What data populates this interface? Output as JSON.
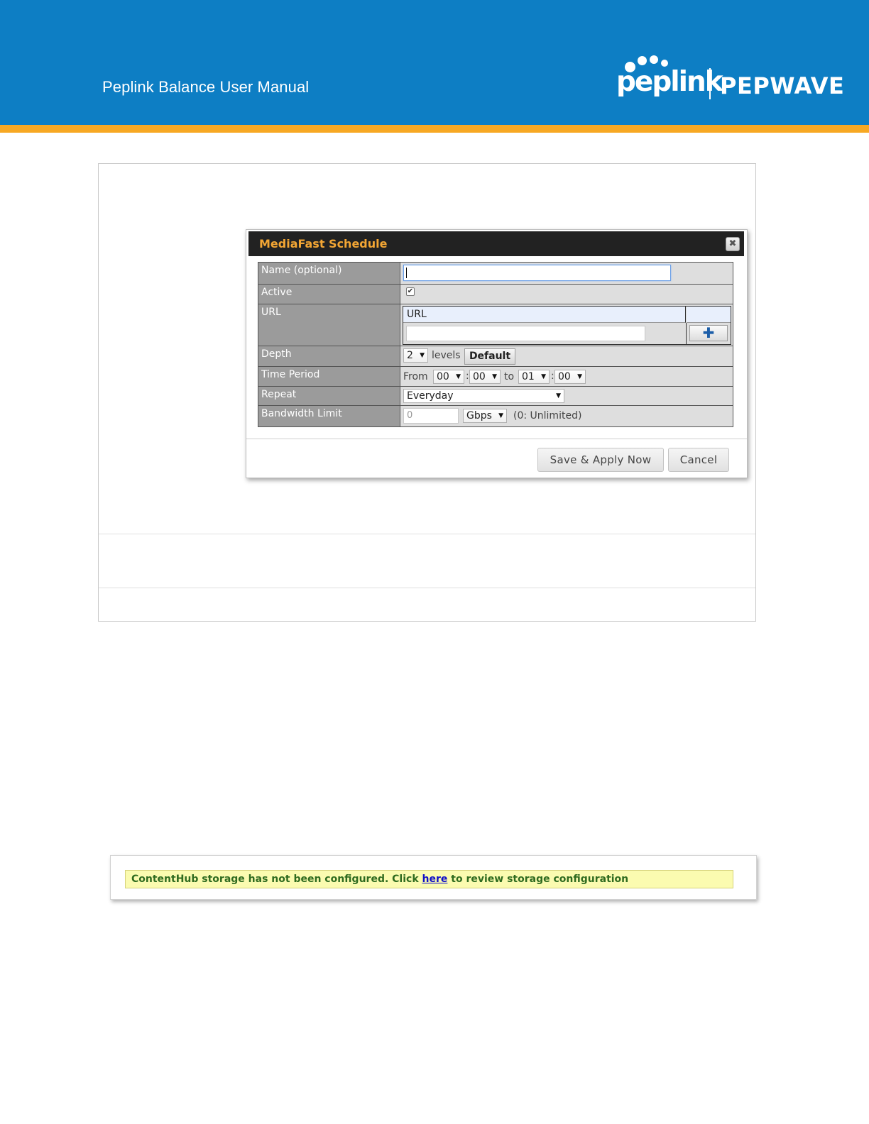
{
  "document": {
    "title": "Peplink Balance User Manual",
    "brand_left": "peplink",
    "brand_right": "PEPWAVE",
    "colors": {
      "header_bg": "#0d7ec4",
      "header_stripe": "#f7a823"
    }
  },
  "dialog": {
    "title": "MediaFast Schedule",
    "close_icon": "close-icon",
    "rows": {
      "name": {
        "label": "Name (optional)",
        "value": ""
      },
      "active": {
        "label": "Active",
        "checked": true
      },
      "url": {
        "label": "URL",
        "column_header": "URL",
        "value": "",
        "add_icon": "plus-icon"
      },
      "depth": {
        "label": "Depth",
        "value": "2",
        "unit": "levels",
        "default_button": "Default"
      },
      "time_period": {
        "label": "Time Period",
        "from_label": "From",
        "from_hour": "00",
        "separator": ":",
        "from_minute": "00",
        "to_label": "to",
        "to_hour": "01",
        "to_minute": "00"
      },
      "repeat": {
        "label": "Repeat",
        "value": "Everyday"
      },
      "bandwidth_limit": {
        "label": "Bandwidth Limit",
        "placeholder": "0",
        "unit": "Gbps",
        "hint": "(0: Unlimited)"
      }
    },
    "buttons": {
      "save": "Save & Apply Now",
      "cancel": "Cancel"
    },
    "colors": {
      "title_text": "#f3a634",
      "titlebar_bg": "#222222",
      "label_bg": "#9b9b9b"
    }
  },
  "notice": {
    "text_before": "ContentHub storage has not been configured. Click ",
    "link_text": "here",
    "text_after": " to review storage configuration",
    "colors": {
      "bg": "#fbfbb0",
      "text": "#2f6b1f",
      "link": "#1010c8"
    }
  }
}
